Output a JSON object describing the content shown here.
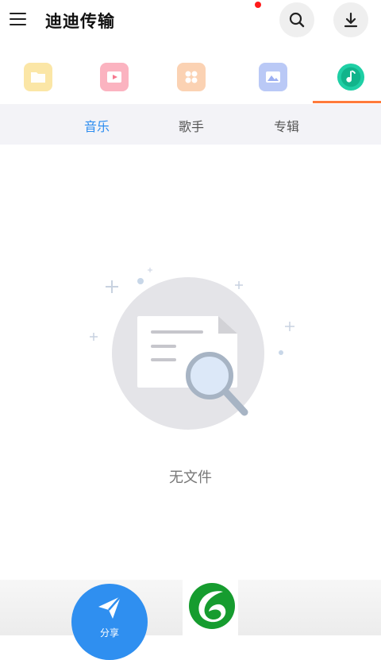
{
  "header": {
    "app_title": "迪迪传输",
    "icons": {
      "menu": "menu-icon",
      "search": "search-icon",
      "download": "download-icon"
    },
    "notification_dot_color": "#ff1a1a"
  },
  "categories": [
    {
      "icon": "folder-icon",
      "color": "#f8d56a",
      "selected": false
    },
    {
      "icon": "video-icon",
      "color": "#f6798f",
      "selected": false
    },
    {
      "icon": "apps-icon",
      "color": "#f6b07a",
      "selected": false
    },
    {
      "icon": "image-icon",
      "color": "#7f9cf0",
      "selected": false
    },
    {
      "icon": "music-icon",
      "color": "#1fcfa5",
      "selected": true
    }
  ],
  "subtabs": [
    {
      "label": "音乐",
      "active": true
    },
    {
      "label": "歌手",
      "active": false
    },
    {
      "label": "专辑",
      "active": false
    }
  ],
  "empty_state": {
    "text": "无文件",
    "icon": "empty-file-search-icon"
  },
  "bottom": {
    "share_label": "分享",
    "share_icon": "send-icon",
    "logo_icon": "green-leaf-logo"
  },
  "colors": {
    "accent": "#2d8df0",
    "tab_underline": "#ff7a3a",
    "share_button": "#2f8ff0"
  }
}
